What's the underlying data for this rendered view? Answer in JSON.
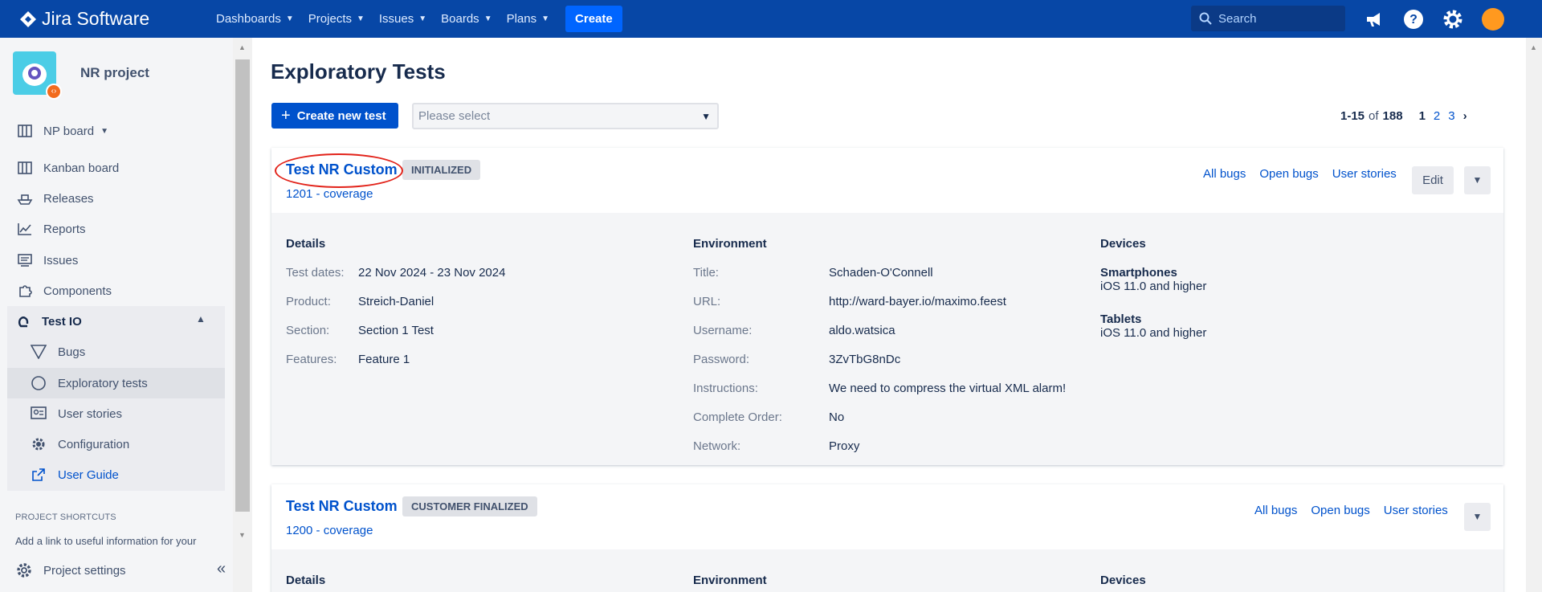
{
  "app": {
    "name": "Jira Software"
  },
  "topnav": {
    "items": [
      {
        "label": "Dashboards"
      },
      {
        "label": "Projects"
      },
      {
        "label": "Issues"
      },
      {
        "label": "Boards"
      },
      {
        "label": "Plans"
      }
    ],
    "create_label": "Create",
    "search_placeholder": "Search"
  },
  "sidebar": {
    "project_name": "NR project",
    "board_label": "NP board",
    "items": [
      {
        "label": "Kanban board",
        "icon": "kanban-icon"
      },
      {
        "label": "Releases",
        "icon": "ship-icon"
      },
      {
        "label": "Reports",
        "icon": "chart-icon"
      },
      {
        "label": "Issues",
        "icon": "issues-icon"
      },
      {
        "label": "Components",
        "icon": "puzzle-icon"
      }
    ],
    "group_label": "Test IO",
    "sub_items": [
      {
        "label": "Bugs"
      },
      {
        "label": "Exploratory tests"
      },
      {
        "label": "User stories"
      },
      {
        "label": "Configuration"
      },
      {
        "label": "User Guide"
      }
    ],
    "shortcuts_heading": "PROJECT SHORTCUTS",
    "shortcuts_text": "Add a link to useful information for your",
    "settings_label": "Project settings"
  },
  "main": {
    "title": "Exploratory Tests",
    "create_button": "Create new test",
    "select_placeholder": "Please select",
    "pager": {
      "range": "1-15",
      "of": "of",
      "total": "188",
      "pages": [
        "1",
        "2",
        "3"
      ]
    }
  },
  "cards": [
    {
      "title": "Test NR Custom",
      "status": "INITIALIZED",
      "subtitle": "1201 - coverage",
      "links": [
        "All bugs",
        "Open bugs",
        "User stories"
      ],
      "edit_label": "Edit",
      "details_heading": "Details",
      "details": [
        {
          "k": "Test dates:",
          "v": "22 Nov 2024 - 23 Nov 2024"
        },
        {
          "k": "Product:",
          "v": "Streich-Daniel"
        },
        {
          "k": "Section:",
          "v": "Section 1 Test"
        },
        {
          "k": "Features:",
          "v": "Feature 1"
        }
      ],
      "env_heading": "Environment",
      "environment": [
        {
          "k": "Title:",
          "v": "Schaden-O'Connell"
        },
        {
          "k": "URL:",
          "v": "http://ward-bayer.io/maximo.feest"
        },
        {
          "k": "Username:",
          "v": "aldo.watsica"
        },
        {
          "k": "Password:",
          "v": "3ZvTbG8nDc"
        },
        {
          "k": "Instructions:",
          "v": "We need to compress the virtual XML alarm!"
        },
        {
          "k": "Complete Order:",
          "v": "No"
        },
        {
          "k": "Network:",
          "v": "Proxy"
        }
      ],
      "devices_heading": "Devices",
      "devices": [
        {
          "name": "Smartphones",
          "req": "iOS 11.0 and higher"
        },
        {
          "name": "Tablets",
          "req": "iOS 11.0 and higher"
        }
      ]
    },
    {
      "title": "Test NR Custom",
      "status": "CUSTOMER FINALIZED",
      "subtitle": "1200 - coverage",
      "links": [
        "All bugs",
        "Open bugs",
        "User stories"
      ],
      "details_heading": "Details",
      "env_heading": "Environment",
      "devices_heading": "Devices"
    }
  ],
  "colors": {
    "nav": "#0747A6",
    "primary": "#0052CC",
    "annotation": "#E2231A"
  }
}
